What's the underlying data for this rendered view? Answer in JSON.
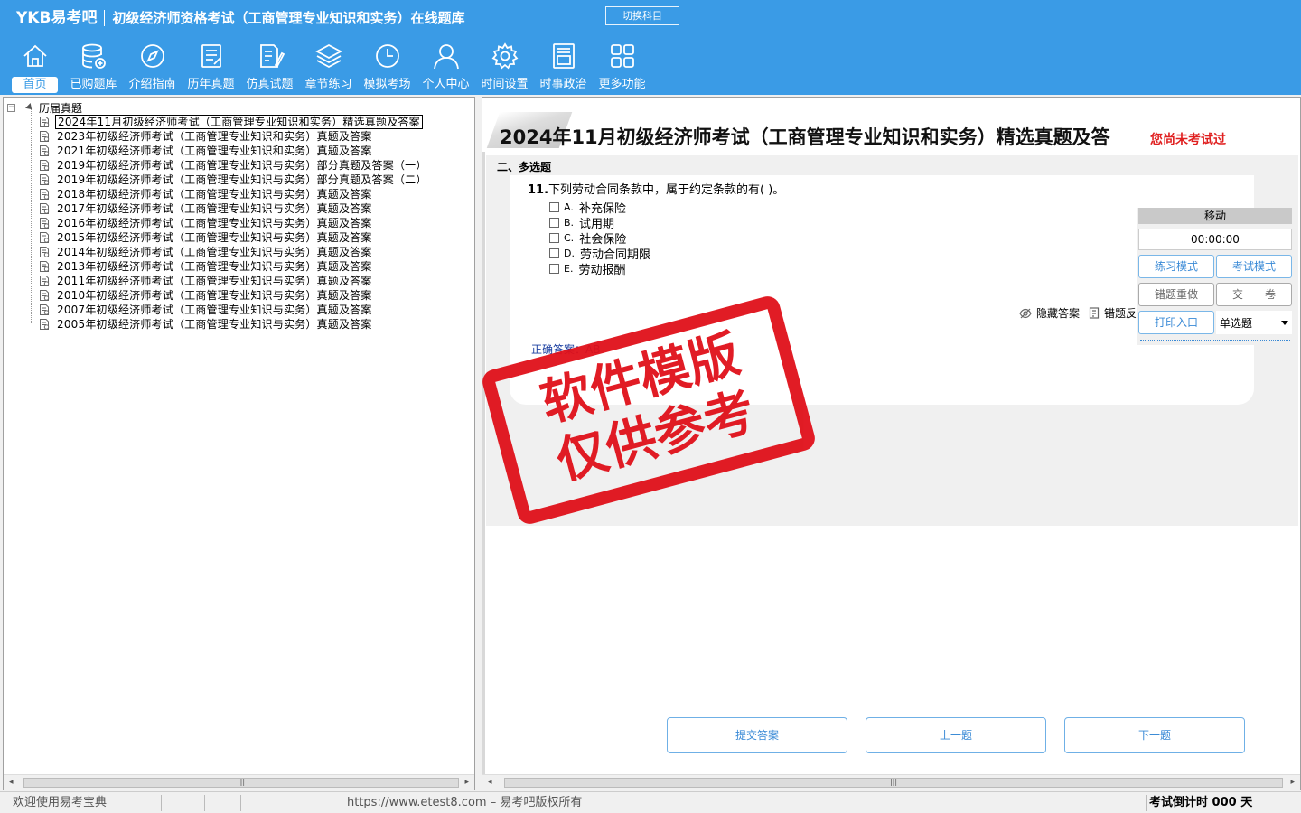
{
  "header": {
    "brand": "YKB易考吧",
    "app_title": "初级经济师资格考试（工商管理专业知识和实务）在线题库",
    "switch_subject": "切换科目"
  },
  "nav": [
    {
      "label": "首页",
      "icon": "home-icon"
    },
    {
      "label": "已购题库",
      "icon": "database-icon"
    },
    {
      "label": "介绍指南",
      "icon": "compass-icon"
    },
    {
      "label": "历年真题",
      "icon": "document-list-icon"
    },
    {
      "label": "仿真试题",
      "icon": "edit-document-icon"
    },
    {
      "label": "章节练习",
      "icon": "layers-icon"
    },
    {
      "label": "模拟考场",
      "icon": "clock-icon"
    },
    {
      "label": "个人中心",
      "icon": "user-icon"
    },
    {
      "label": "时间设置",
      "icon": "gear-icon"
    },
    {
      "label": "时事政治",
      "icon": "newspaper-icon"
    },
    {
      "label": "更多功能",
      "icon": "grid-icon"
    }
  ],
  "tree": {
    "expander": "−",
    "root": "历届真题",
    "items": [
      "2024年11月初级经济师考试（工商管理专业知识和实务）精选真题及答案",
      "2023年初级经济师考试（工商管理专业知识和实务）真题及答案",
      "2021年初级经济师考试（工商管理专业知识和实务）真题及答案",
      "2019年初级经济师考试（工商管理专业知识与实务）部分真题及答案（一）",
      "2019年初级经济师考试（工商管理专业知识与实务）部分真题及答案（二）",
      "2018年初级经济师考试（工商管理专业知识与实务）真题及答案",
      "2017年初级经济师考试（工商管理专业知识与实务）真题及答案",
      "2016年初级经济师考试（工商管理专业知识与实务）真题及答案",
      "2015年初级经济师考试（工商管理专业知识与实务）真题及答案",
      "2014年初级经济师考试（工商管理专业知识与实务）真题及答案",
      "2013年初级经济师考试（工商管理专业知识与实务）真题及答案",
      "2011年初级经济师考试（工商管理专业知识与实务）真题及答案",
      "2010年初级经济师考试（工商管理专业知识与实务）真题及答案",
      "2007年初级经济师考试（工商管理专业知识与实务）真题及答案",
      "2005年初级经济师考试（工商管理专业知识与实务）真题及答案"
    ]
  },
  "question": {
    "title": "2024年11月初级经济师考试（工商管理专业知识和实务）精选真题及答",
    "status": "您尚未考试过",
    "section": "二、多选题",
    "number": "11.",
    "text": "下列劳动合同条款中，属于约定条款的有( )。",
    "options": [
      {
        "letter": "A.",
        "text": "补充保险"
      },
      {
        "letter": "B.",
        "text": "试用期"
      },
      {
        "letter": "C.",
        "text": "社会保险"
      },
      {
        "letter": "D.",
        "text": "劳动合同期限"
      },
      {
        "letter": "E.",
        "text": "劳动报酬"
      }
    ],
    "hide_answer": "隐藏答案",
    "report_error": "错题反馈",
    "correct_answer": "正确答案：AB"
  },
  "control": {
    "move": "移动",
    "timer": "00:00:00",
    "practice_mode": "练习模式",
    "exam_mode": "考试模式",
    "redo_wrong": "错题重做",
    "submit_paper": "交　　卷",
    "print": "打印入口",
    "type_select": "单选题"
  },
  "buttons": {
    "submit": "提交答案",
    "prev": "上一题",
    "next": "下一题"
  },
  "stamp": {
    "line1": "软件模版",
    "line2": "仅供参考"
  },
  "statusbar": {
    "welcome": "欢迎使用易考宝典",
    "copyright": "https://www.etest8.com – 易考吧版权所有",
    "countdown": "考试倒计时 000 天"
  },
  "scrollbar": {
    "left_arrow": "◂",
    "right_arrow": "▸",
    "grip": "|||"
  }
}
